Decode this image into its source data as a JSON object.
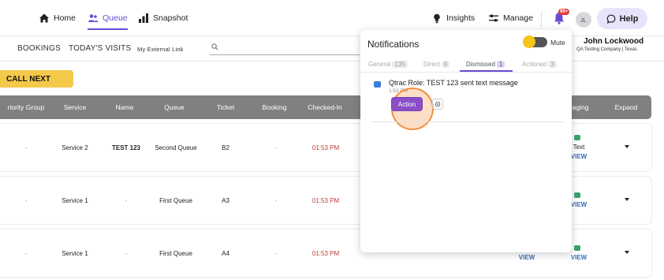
{
  "nav": {
    "home": "Home",
    "queue": "Queue",
    "snapshot": "Snapshot",
    "insights": "Insights",
    "manage": "Manage",
    "bell_badge": "99+",
    "avatar_initials": "JL",
    "help": "Help"
  },
  "subnav": {
    "bookings": "BOOKINGS",
    "todays_visits": "TODAY'S VISITS",
    "external_link": "My External Link"
  },
  "user": {
    "name": "John Lockwood",
    "company": "QA Testing Company | Texas"
  },
  "call_next": "CALL NEXT",
  "table": {
    "headers": [
      "riority Group",
      "Service",
      "Name",
      "Queue",
      "Ticket",
      "Booking",
      "Checked-In",
      "saging",
      "Expand"
    ],
    "rows": [
      {
        "priority": "-",
        "service": "Service 2",
        "name": "TEST 123",
        "queue": "Second Queue",
        "ticket": "B2",
        "booking": "-",
        "checked_in": "01:53 PM",
        "msg1": "Text",
        "msg2": "VIEW"
      },
      {
        "priority": "-",
        "service": "Service 1",
        "name": "-",
        "queue": "First Queue",
        "ticket": "A3",
        "booking": "-",
        "checked_in": "01:53 PM",
        "msg1": "VIEW",
        "msg2": ""
      },
      {
        "priority": "-",
        "service": "Service 1",
        "name": "-",
        "queue": "First Queue",
        "ticket": "A4",
        "booking": "-",
        "checked_in": "01:53 PM",
        "msg1": "VIEW",
        "msg2": "VIEW"
      }
    ]
  },
  "notifications": {
    "title": "Notifications",
    "mute_label": "Mute",
    "tabs": [
      {
        "label": "General",
        "count": "135"
      },
      {
        "label": "Direct",
        "count": "0"
      },
      {
        "label": "Dismissed",
        "count": "1"
      },
      {
        "label": "Actioned",
        "count": "3"
      }
    ],
    "item": {
      "text": "Qtrac Role: TEST 123 sent text message",
      "time": "1:53 PM",
      "action_label": "Action"
    }
  },
  "colors": {
    "accent": "#6b4bd3",
    "call_next": "#f4c94a",
    "action": "#8a4fc7",
    "header_bg": "#808080"
  }
}
